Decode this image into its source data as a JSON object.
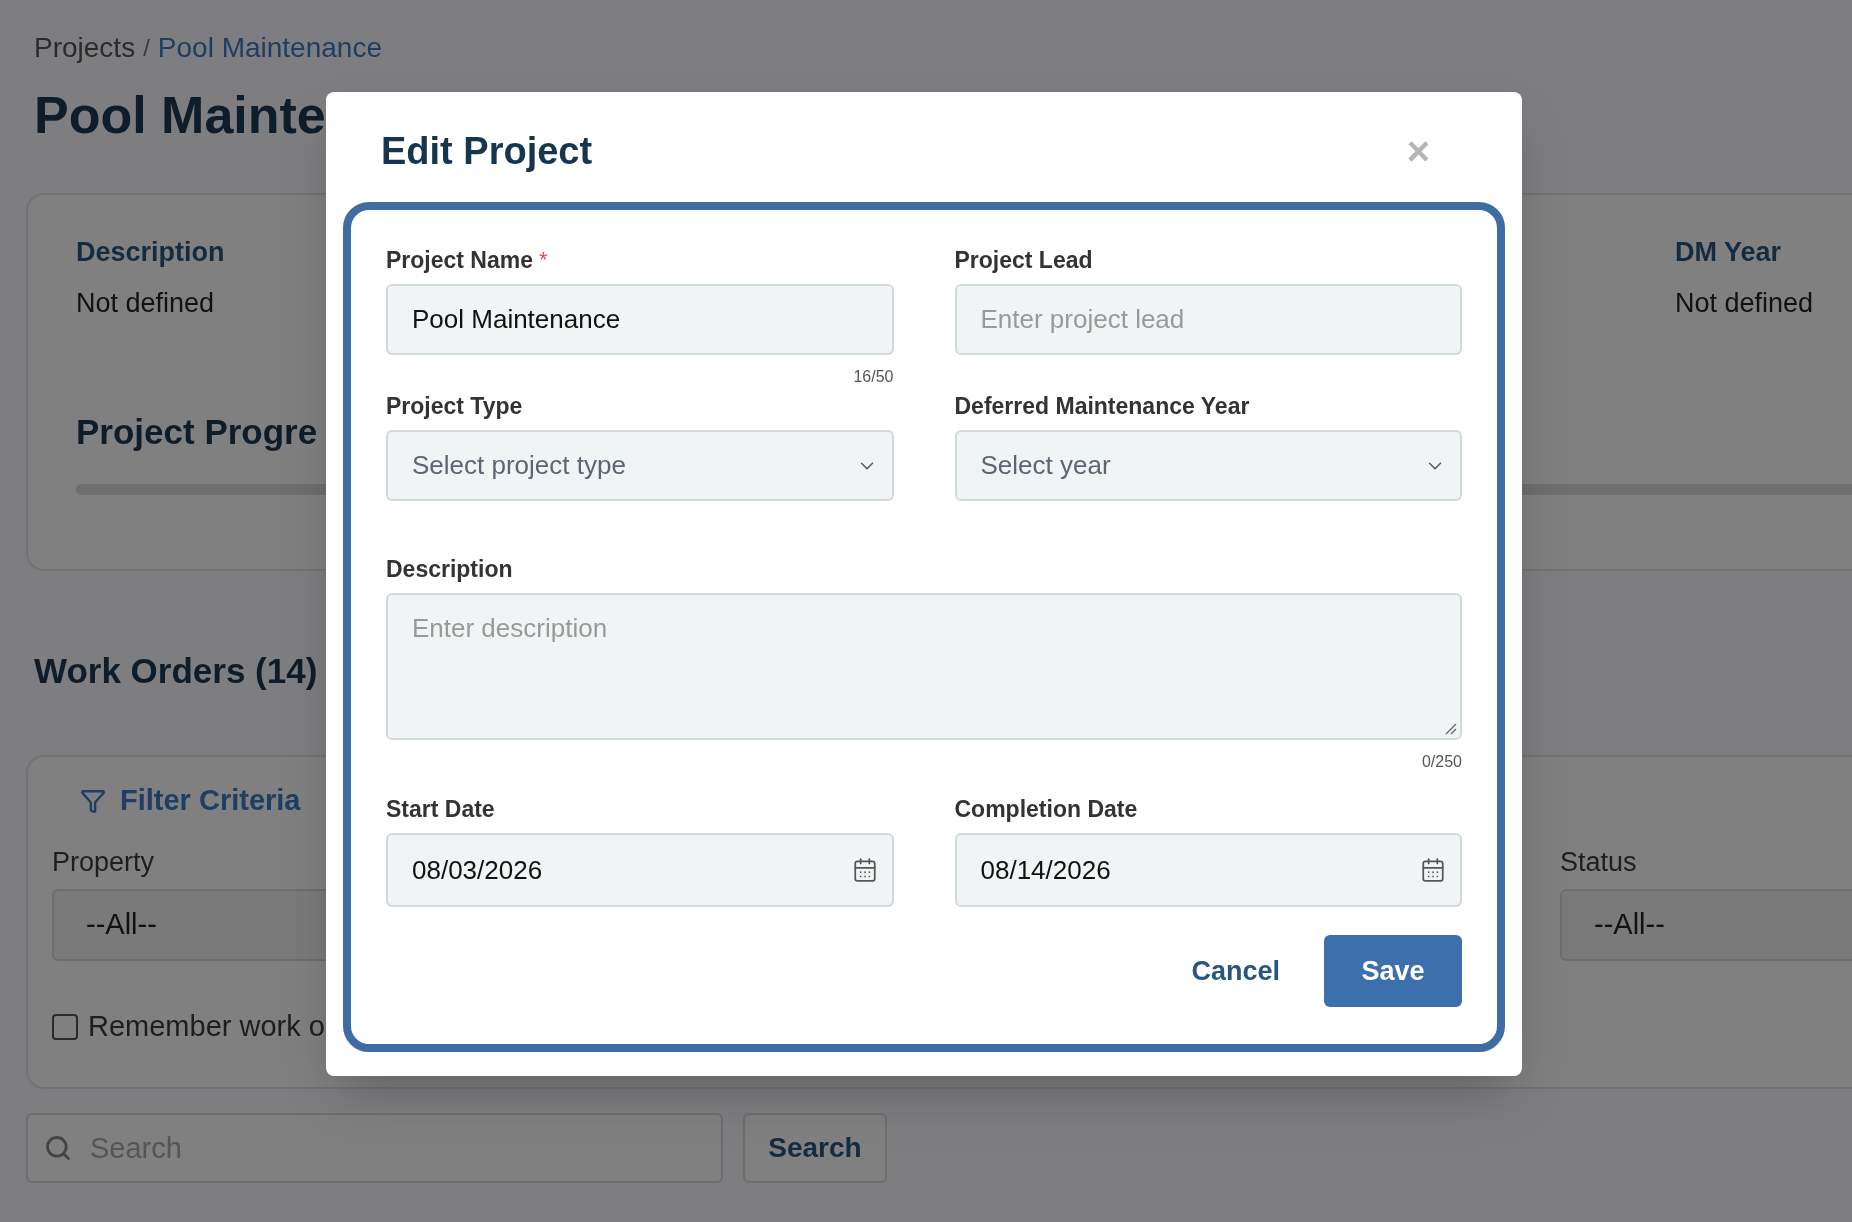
{
  "breadcrumb": {
    "parent": "Projects",
    "separator": "/",
    "current": "Pool Maintenance"
  },
  "page_title": "Pool Mainte",
  "summary": [
    {
      "label": "Description",
      "value": "Not defined"
    },
    {
      "label": "DM Year",
      "value": "Not defined"
    }
  ],
  "progress_title": "Project Progre",
  "work_orders_title": "Work Orders (14)",
  "filter": {
    "title": "Filter Criteria",
    "fields": [
      {
        "label": "Property",
        "value": "--All--"
      },
      {
        "label": "Status",
        "value": "--All--"
      }
    ],
    "remember": {
      "label": "Remember work o",
      "checked": false
    }
  },
  "search": {
    "placeholder": "Search",
    "button": "Search"
  },
  "modal": {
    "title": "Edit Project",
    "close": "×",
    "required_mark": "*",
    "fields": [
      {
        "kind": "text",
        "label": "Project Name",
        "required": true,
        "value": "Pool Maintenance",
        "counter": "16/50"
      },
      {
        "kind": "text",
        "label": "Project Lead",
        "required": false,
        "placeholder": "Enter project lead"
      },
      {
        "kind": "select",
        "label": "Project Type",
        "required": false,
        "placeholder": "Select project type"
      },
      {
        "kind": "select",
        "label": "Deferred Maintenance Year",
        "required": false,
        "placeholder": "Select year"
      },
      {
        "kind": "textarea",
        "label": "Description",
        "required": false,
        "placeholder": "Enter description",
        "counter": "0/250"
      },
      {
        "kind": "date",
        "label": "Start Date",
        "required": false,
        "value": "08/03/2026"
      },
      {
        "kind": "date",
        "label": "Completion Date",
        "required": false,
        "value": "08/14/2026"
      }
    ],
    "buttons": [
      {
        "kind": "link",
        "label": "Cancel"
      },
      {
        "kind": "primary",
        "label": "Save"
      }
    ]
  }
}
